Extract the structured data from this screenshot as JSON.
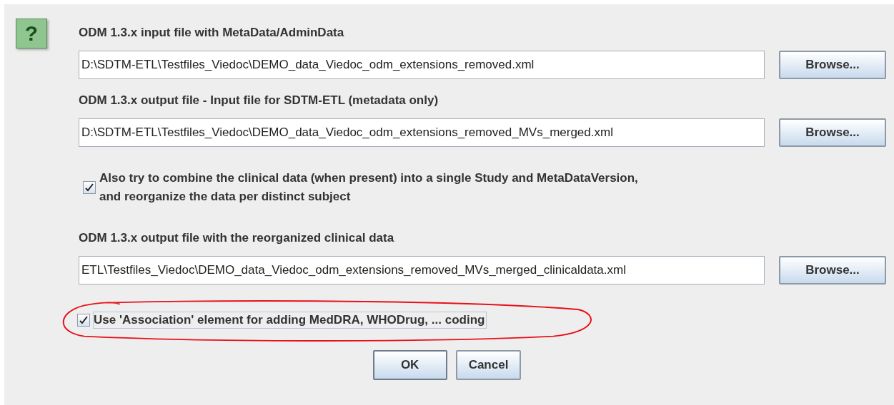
{
  "help_icon": {
    "label": "?"
  },
  "sections": [
    {
      "kind": "file",
      "label": "ODM 1.3.x input file with MetaData/AdminData",
      "value": "D:\\SDTM-ETL\\Testfiles_Viedoc\\DEMO_data_Viedoc_odm_extensions_removed.xml",
      "button": "Browse..."
    },
    {
      "kind": "file",
      "label": "ODM 1.3.x output file - Input file for SDTM-ETL (metadata only)",
      "value": "D:\\SDTM-ETL\\Testfiles_Viedoc\\DEMO_data_Viedoc_odm_extensions_removed_MVs_merged.xml",
      "button": "Browse..."
    },
    {
      "kind": "checkbox",
      "lines": [
        "Also try to combine the clinical data (when present) into a single Study and MetaDataVersion,",
        "and reorganize the data per distinct subject"
      ],
      "checked": true,
      "focused": false,
      "circled": false
    },
    {
      "kind": "file",
      "label": "ODM 1.3.x output file with the reorganized clinical data",
      "value": "ETL\\Testfiles_Viedoc\\DEMO_data_Viedoc_odm_extensions_removed_MVs_merged_clinicaldata.xml",
      "button": "Browse..."
    },
    {
      "kind": "checkbox",
      "lines": [
        "Use 'Association' element for adding MedDRA, WHODrug, ... coding"
      ],
      "checked": true,
      "focused": true,
      "circled": true
    }
  ],
  "buttons": [
    {
      "label": "OK",
      "default": true
    },
    {
      "label": "Cancel",
      "default": false
    }
  ]
}
